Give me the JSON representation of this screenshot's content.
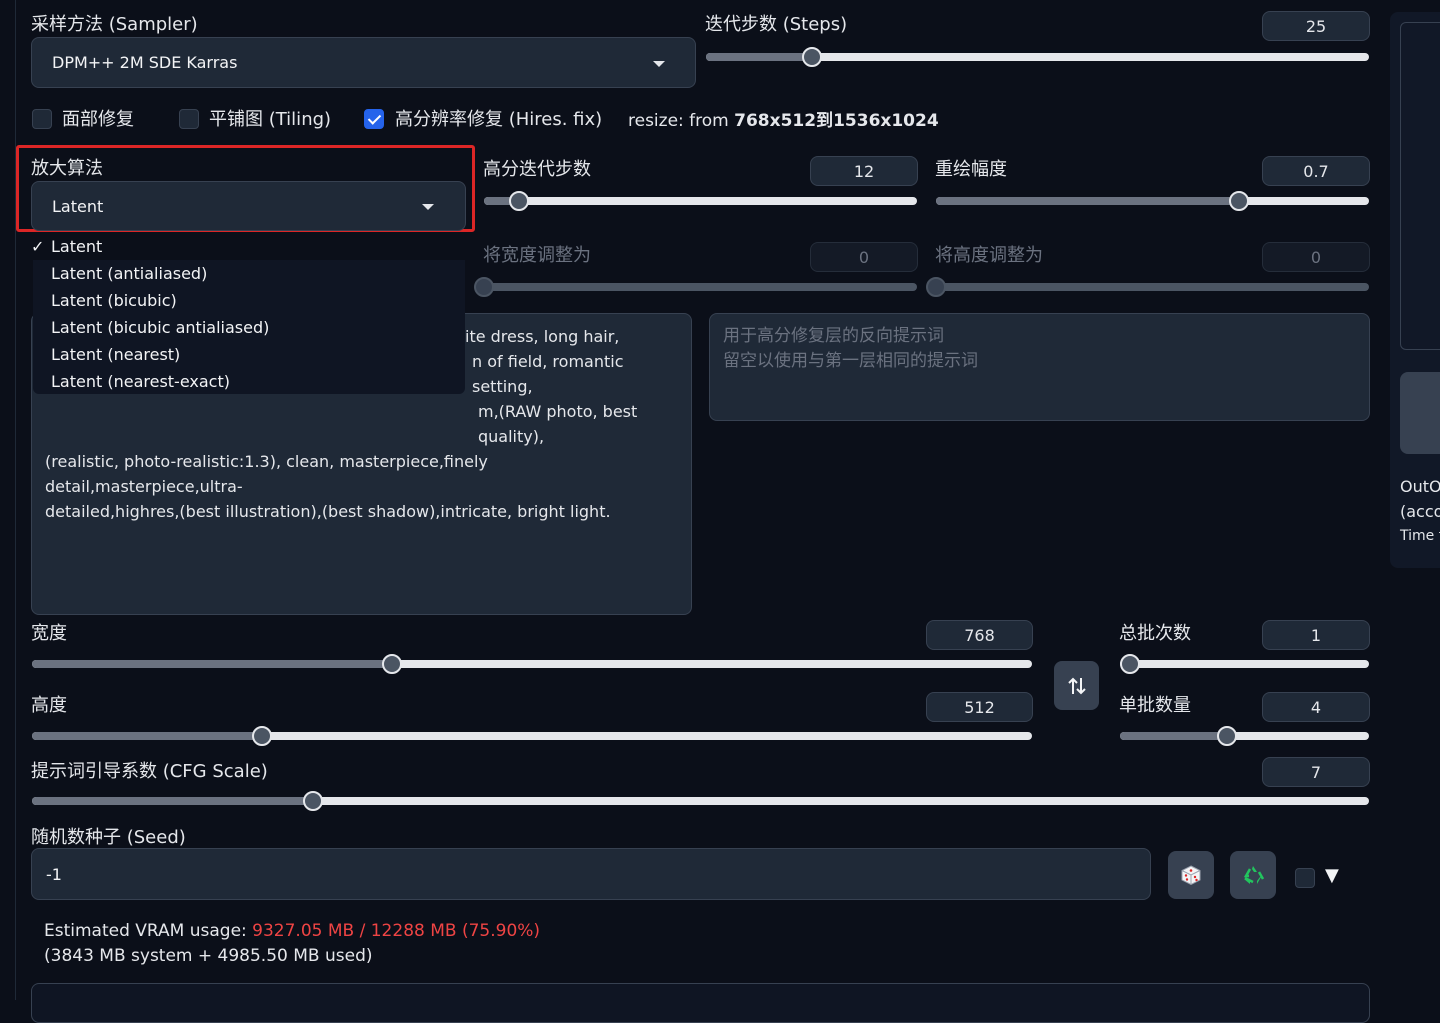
{
  "sampler": {
    "label": "采样方法 (Sampler)",
    "value": "DPM++ 2M SDE Karras"
  },
  "steps": {
    "label": "迭代步数 (Steps)",
    "value": "25",
    "fraction": 0.16
  },
  "options": {
    "face_restore": {
      "label": "面部修复",
      "checked": false
    },
    "tiling": {
      "label": "平铺图 (Tiling)",
      "checked": false
    },
    "hires_fix": {
      "label": "高分辨率修复 (Hires. fix)",
      "checked": true
    },
    "resize_prefix": "resize: from ",
    "resize_value": "768x512到1536x1024"
  },
  "upscaler": {
    "label": "放大算法",
    "value": "Latent",
    "options": [
      {
        "label": "Latent",
        "selected": true,
        "check": "✓"
      },
      {
        "label": "Latent (antialiased)"
      },
      {
        "label": "Latent (bicubic)"
      },
      {
        "label": "Latent (bicubic antialiased)"
      },
      {
        "label": "Latent (nearest)"
      },
      {
        "label": "Latent (nearest-exact)"
      }
    ]
  },
  "hires_steps": {
    "label": "高分迭代步数",
    "value": "12",
    "fraction": 0.08
  },
  "denoise": {
    "label": "重绘幅度",
    "value": "0.7",
    "fraction": 0.7
  },
  "resize_width": {
    "label": "将宽度调整为",
    "value": "0",
    "fraction": 0
  },
  "resize_height": {
    "label": "将高度调整为",
    "value": "0",
    "fraction": 0
  },
  "hires_prompt": {
    "visible_lines": [
      "ite dress, long hair,",
      "n of field, romantic setting,",
      "m,(RAW photo, best quality),"
    ],
    "line4": "(realistic, photo-realistic:1.3), clean, masterpiece,finely detail,masterpiece,ultra-",
    "line5": "detailed,highres,(best illustration),(best shadow),intricate, bright light."
  },
  "hires_negative": {
    "placeholder_line1": "用于高分修复层的反向提示词",
    "placeholder_line2": "留空以使用与第一层相同的提示词"
  },
  "width": {
    "label": "宽度",
    "value": "768",
    "fraction": 0.36
  },
  "height": {
    "label": "高度",
    "value": "512",
    "fraction": 0.23
  },
  "batch_count": {
    "label": "总批次数",
    "value": "1",
    "fraction": 0.04
  },
  "batch_size": {
    "label": "单批数量",
    "value": "4",
    "fraction": 0.43
  },
  "swap_icon": "swap-dimensions-icon",
  "cfg": {
    "label": "提示词引导系数 (CFG Scale)",
    "value": "7",
    "fraction": 0.21
  },
  "seed": {
    "label": "随机数种子 (Seed)",
    "value": "-1"
  },
  "seed_buttons": {
    "random_icon": "dice-icon",
    "reuse_icon": "recycle-icon",
    "extra_arrow": "▼"
  },
  "vram": {
    "prefix": "Estimated VRAM usage: ",
    "usage": "9327.05 MB / 12288 MB (75.90%)",
    "detail": "(3843 MB system + 4985.50 MB used)",
    "usage_color": "#ef4444"
  },
  "right_panel": {
    "line1": "OutO",
    "line2": "(acco",
    "line3": "Time t"
  },
  "colors": {
    "accent": "#2563eb",
    "highlight_border": "#dc2626",
    "background": "#0b0f19"
  }
}
